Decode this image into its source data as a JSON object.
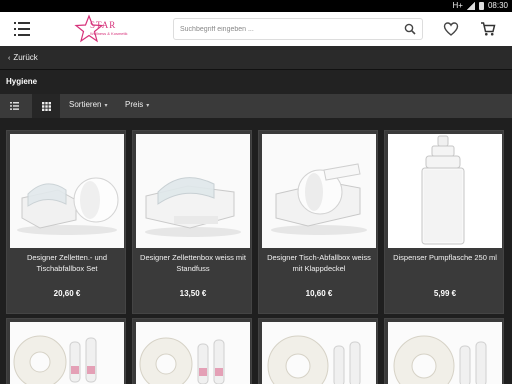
{
  "status_bar": {
    "network": "H+",
    "time": "08:30"
  },
  "header": {
    "logo_text": "STAR",
    "logo_sub": "Wellness & Kosmetik",
    "search_placeholder": "Suchbegriff eingeben ..."
  },
  "nav": {
    "back_label": "Zurück"
  },
  "category": {
    "title": "Hygiene"
  },
  "toolbar": {
    "sort_label": "Sortieren",
    "price_label": "Preis"
  },
  "icons": [
    "menu-icon",
    "search-icon",
    "heart-icon",
    "cart-icon",
    "list-view-icon",
    "grid-view-icon",
    "chevron-left-icon",
    "chevron-down-icon"
  ],
  "colors": {
    "brand": "#d6317a",
    "card_bg": "#3a3a3a",
    "page_bg": "#1f1f1f"
  },
  "products": [
    {
      "name": "Designer Zelletten.- und Tischabfallbox Set",
      "price": "20,60 €"
    },
    {
      "name": "Designer Zellettenbox weiss mit Standfuss",
      "price": "13,50 €"
    },
    {
      "name": "Designer Tisch-Abfallbox weiss mit Klappdeckel",
      "price": "10,60 €"
    },
    {
      "name": "Dispenser Pumpflasche 250 ml",
      "price": "5,99 €"
    }
  ]
}
